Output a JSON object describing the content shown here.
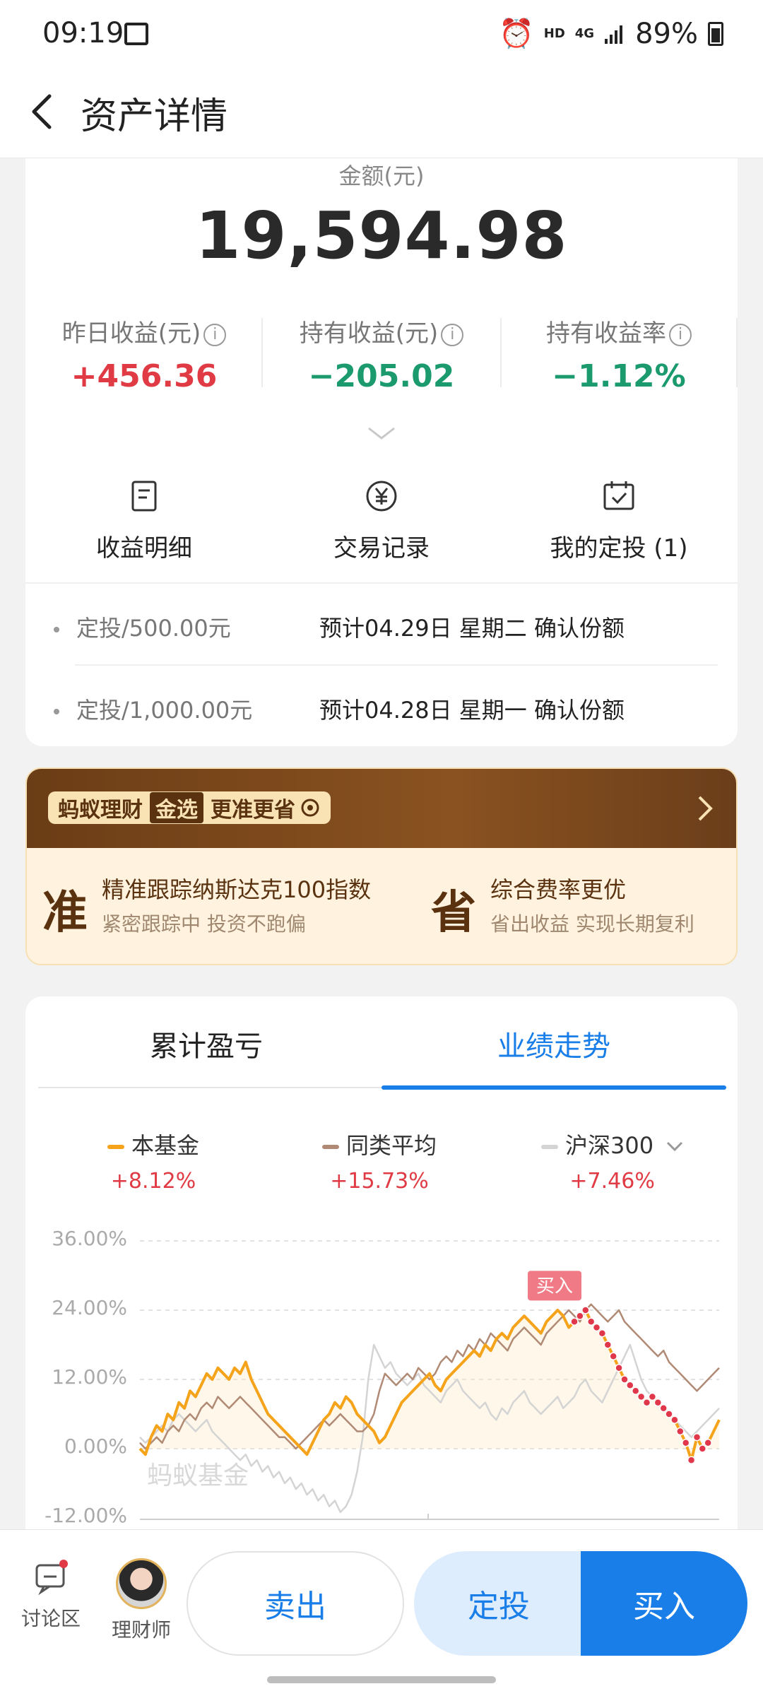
{
  "status_bar": {
    "time": "09:19",
    "hd": "HD",
    "network": "4G",
    "battery": "89%"
  },
  "header": {
    "title": "资产详情"
  },
  "asset": {
    "amount_label": "金额(元)",
    "amount_value": "19,594.98",
    "stats": [
      {
        "label": "昨日收益(元)",
        "value": "+456.36",
        "tone": "red"
      },
      {
        "label": "持有收益(元)",
        "value": "−205.02",
        "tone": "green"
      },
      {
        "label": "持有收益率",
        "value": "−1.12%",
        "tone": "green"
      }
    ],
    "info_icon_glyph": "i"
  },
  "quick_actions": [
    {
      "label": "收益明细",
      "icon": "document-icon"
    },
    {
      "label": "交易记录",
      "icon": "yuan-icon"
    },
    {
      "label": "我的定投 (1)",
      "icon": "calendar-check-icon"
    }
  ],
  "plans": [
    {
      "left": "定投/500.00元",
      "right": "预计04.29日 星期二 确认份额"
    },
    {
      "left": "定投/1,000.00元",
      "right": "预计04.28日 星期一 确认份额"
    }
  ],
  "banner": {
    "brand": "蚂蚁理财",
    "gold_tag": "金选",
    "slogan": "更准更省",
    "perks": [
      {
        "glyph": "准",
        "title": "精准跟踪纳斯达克100指数",
        "subtitle": "紧密跟踪中 投资不跑偏"
      },
      {
        "glyph": "省",
        "title": "综合费率更优",
        "subtitle": "省出收益 实现长期复利"
      }
    ]
  },
  "tabs": [
    {
      "label": "累计盈亏",
      "active": false
    },
    {
      "label": "业绩走势",
      "active": true
    }
  ],
  "legend": [
    {
      "name": "本基金",
      "pct": "+8.12%",
      "color": "#f5a31a"
    },
    {
      "name": "同类平均",
      "pct": "+15.73%",
      "color": "#b08a74"
    },
    {
      "name": "沪深300",
      "pct": "+7.46%",
      "color": "#d4d4d4"
    }
  ],
  "chart_data": {
    "type": "line",
    "yticks": [
      "36.00%",
      "24.00%",
      "12.00%",
      "0.00%",
      "-12.00%"
    ],
    "ylim": [
      -12,
      36
    ],
    "buy_marker_label": "买入",
    "watermark": "蚂蚁基金",
    "series": [
      {
        "name": "本基金",
        "color": "#f5a31a",
        "values": [
          0,
          -1,
          2,
          4,
          3,
          6,
          5,
          8,
          7,
          10,
          9,
          11,
          13,
          12,
          14,
          13,
          12,
          14,
          13,
          15,
          12,
          10,
          8,
          6,
          5,
          4,
          3,
          2,
          1,
          0,
          -1,
          1,
          3,
          5,
          6,
          8,
          7,
          9,
          8,
          6,
          5,
          4,
          3,
          1,
          2,
          4,
          6,
          8,
          9,
          10,
          11,
          12,
          13,
          11,
          10,
          12,
          13,
          14,
          15,
          16,
          17,
          16,
          18,
          17,
          19,
          20,
          19,
          21,
          22,
          23,
          22,
          21,
          20,
          22,
          23,
          24,
          23,
          21,
          22,
          23,
          24,
          22,
          21,
          20,
          18,
          16,
          14,
          12,
          11,
          10,
          9,
          8,
          9,
          8,
          7,
          6,
          5,
          3,
          1,
          -2,
          2,
          0,
          1,
          3,
          5
        ]
      },
      {
        "name": "同类平均",
        "color": "#b08a74",
        "values": [
          1,
          0,
          1,
          2,
          1,
          3,
          4,
          3,
          5,
          6,
          5,
          7,
          8,
          7,
          9,
          8,
          7,
          8,
          9,
          8,
          7,
          6,
          5,
          4,
          3,
          2,
          2,
          1,
          0,
          1,
          2,
          3,
          4,
          5,
          4,
          5,
          6,
          5,
          4,
          3,
          3,
          4,
          6,
          10,
          13,
          12,
          11,
          12,
          13,
          12,
          14,
          13,
          12,
          13,
          15,
          16,
          15,
          17,
          16,
          18,
          17,
          19,
          18,
          20,
          19,
          18,
          17,
          19,
          20,
          21,
          20,
          19,
          18,
          20,
          21,
          22,
          23,
          24,
          23,
          22,
          24,
          25,
          24,
          23,
          22,
          23,
          24,
          22,
          21,
          20,
          19,
          18,
          17,
          16,
          17,
          15,
          14,
          13,
          12,
          11,
          10,
          11,
          12,
          13,
          14
        ]
      },
      {
        "name": "沪深300",
        "color": "#d4d4d4",
        "values": [
          2,
          1,
          2,
          3,
          4,
          3,
          5,
          6,
          5,
          4,
          3,
          4,
          5,
          3,
          2,
          1,
          0,
          -1,
          -2,
          -1,
          -3,
          -2,
          -4,
          -3,
          -5,
          -4,
          -6,
          -5,
          -7,
          -6,
          -8,
          -7,
          -9,
          -8,
          -10,
          -9,
          -11,
          -10,
          -8,
          -4,
          2,
          12,
          18,
          16,
          14,
          15,
          13,
          12,
          11,
          12,
          13,
          11,
          10,
          9,
          8,
          10,
          11,
          12,
          10,
          9,
          8,
          7,
          8,
          6,
          5,
          7,
          6,
          8,
          9,
          10,
          8,
          7,
          6,
          7,
          8,
          9,
          7,
          8,
          9,
          11,
          12,
          10,
          9,
          8,
          10,
          12,
          14,
          16,
          18,
          15,
          12,
          10,
          9,
          8,
          7,
          6,
          5,
          4,
          3,
          2,
          3,
          4,
          5,
          6,
          7
        ]
      }
    ]
  },
  "bottom_bar": {
    "discuss_label": "讨论区",
    "advisor_label": "理财师",
    "sell_label": "卖出",
    "plan_label": "定投",
    "buy_label": "买入"
  }
}
